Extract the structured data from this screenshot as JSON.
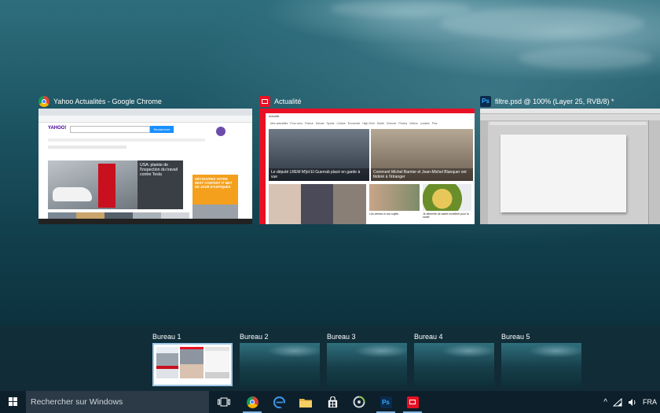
{
  "windows": [
    {
      "id": "chrome",
      "title": "Yahoo Actualités - Google Chrome",
      "icon": "chrome-icon",
      "thumb": {
        "headline": "USA: plainte de l'inspection du travail contre Tesla",
        "brand": "YAHOO!",
        "search_button": "Rechercher",
        "ad_text": "DÉCOUVREZ VOTRE BEST CONTENT IT MET DE JOUR D'ANTIQUES"
      }
    },
    {
      "id": "news",
      "title": "Actualité",
      "icon": "news-icon",
      "thumb": {
        "app_name": "Actualité",
        "nav": [
          "Mes actualités",
          "Pour vous",
          "France",
          "Monde",
          "Sports",
          "Culture",
          "Économie",
          "High-Tech",
          "Santé",
          "Science",
          "Photos",
          "Vidéos",
          "Locales",
          "Plus"
        ],
        "story1": "Le député LREM M'jid El Guerrab placé en garde à vue",
        "story2": "Comment Michel Barnier et Jean-Michel Blanquer ont fédéré à l'étranger",
        "story3": "Les cerises à vos sujets",
        "story4": "Je alimente de santé excellent pour la santé"
      }
    },
    {
      "id": "ps",
      "title": "filtre.psd @ 100% (Layer 25, RVB/8) *",
      "icon": "ps-icon",
      "icon_text": "Ps"
    }
  ],
  "desktops": [
    {
      "label": "Bureau 1",
      "active": true
    },
    {
      "label": "Bureau 2",
      "active": false
    },
    {
      "label": "Bureau 3",
      "active": false
    },
    {
      "label": "Bureau 4",
      "active": false
    },
    {
      "label": "Bureau 5",
      "active": false
    }
  ],
  "taskbar": {
    "search_placeholder": "Rechercher sur Windows",
    "apps": [
      {
        "name": "chrome",
        "icon": "chrome-icon",
        "running": true
      },
      {
        "name": "edge",
        "icon": "edge-icon",
        "running": false
      },
      {
        "name": "file-explorer",
        "icon": "folder-icon",
        "running": false
      },
      {
        "name": "store",
        "icon": "store-icon",
        "running": false
      },
      {
        "name": "app",
        "icon": "spin-icon",
        "running": false
      },
      {
        "name": "photoshop",
        "icon": "ps-icon",
        "running": true
      },
      {
        "name": "news",
        "icon": "news-icon",
        "running": true
      }
    ],
    "tray_lang": "FRA",
    "tray_chevron": "^"
  },
  "colors": {
    "accent": "#0078d7",
    "news_red": "#e81123",
    "ps_blue": "#31a8ff"
  }
}
